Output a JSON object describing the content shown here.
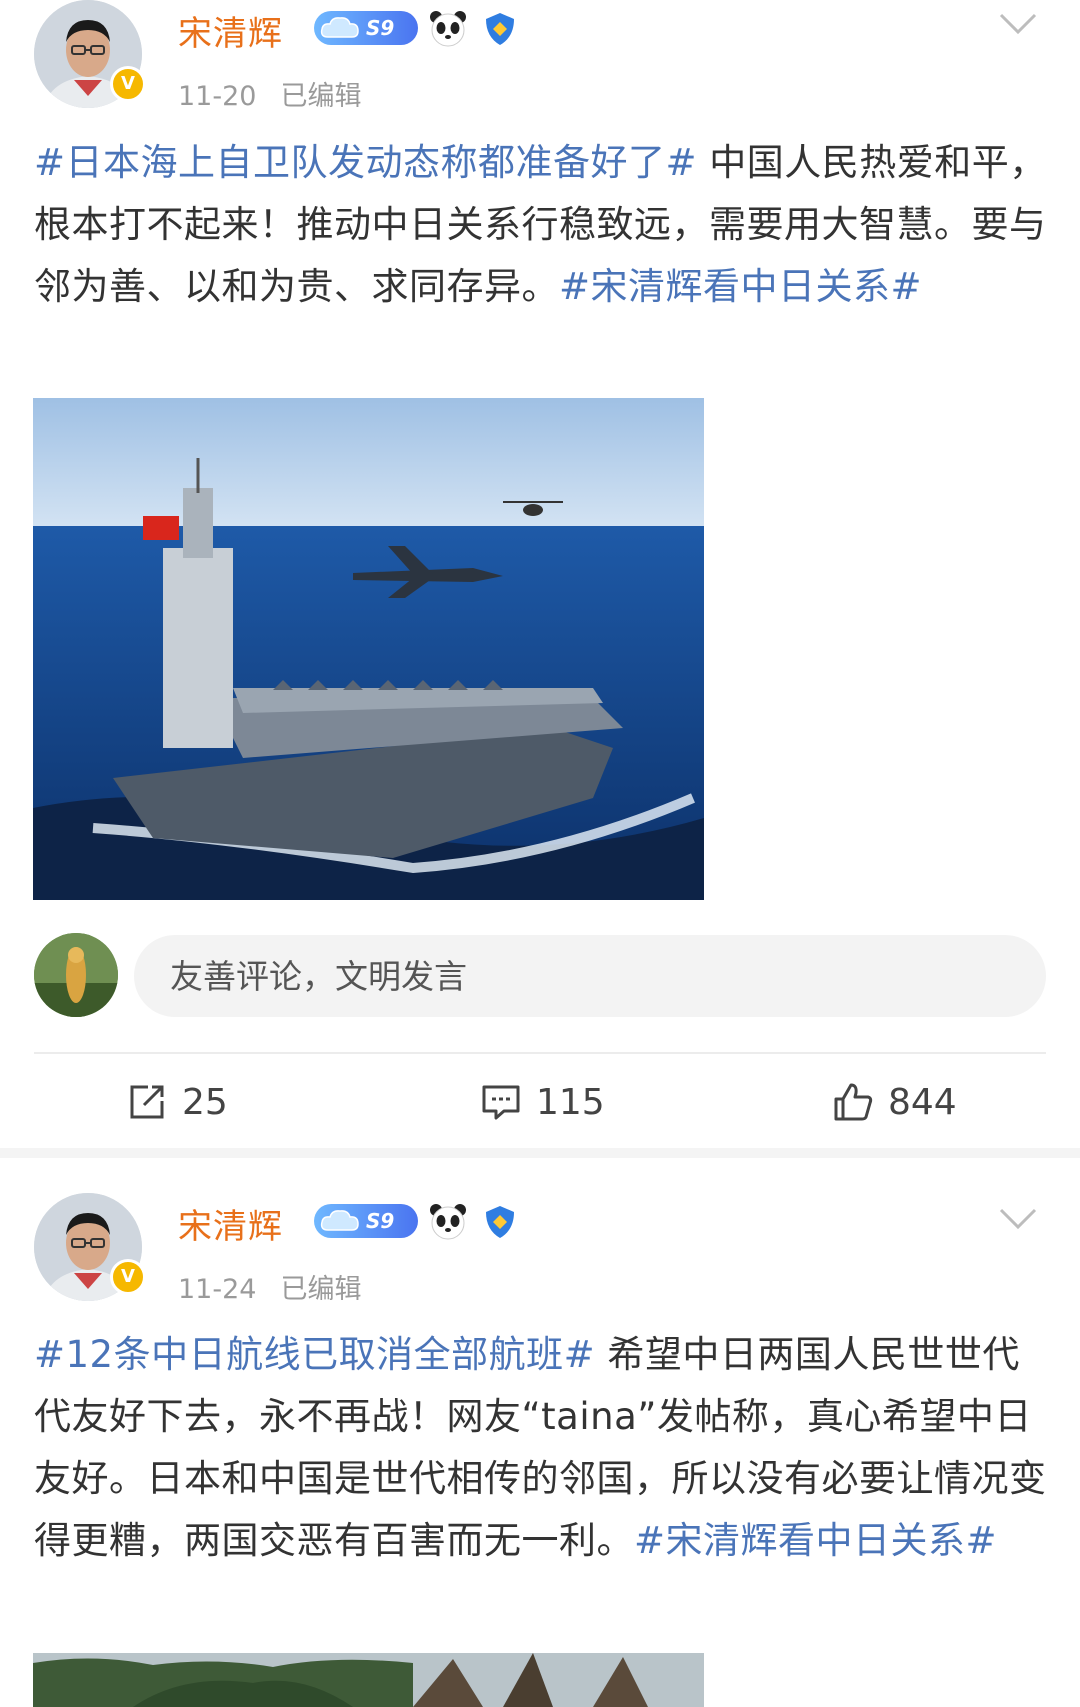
{
  "posts": [
    {
      "author": "宋清辉",
      "level_badge": "S9",
      "date": "11-20",
      "edited_label": "已编辑",
      "text": {
        "hashtag1": "#日本海上自卫队发动态称都准备好了#",
        "body": "中国人民热爱和平，根本打不起来！推动中日关系行稳致远，需要用大智慧。要与邻为善、以和为贵、求同存异。",
        "hashtag2": "#宋清辉看中日关系#"
      },
      "image": {
        "subject": "aircraft-carrier-photo"
      },
      "comment_placeholder": "友善评论，文明发言",
      "actions": {
        "repost": "25",
        "comment": "115",
        "like": "844"
      }
    },
    {
      "author": "宋清辉",
      "level_badge": "S9",
      "date": "11-24",
      "edited_label": "已编辑",
      "text": {
        "hashtag1": "#12条中日航线已取消全部航班#",
        "body": "希望中日两国人民世世代代友好下去，永不再战！网友“taina”发帖称，真心希望中日友好。日本和中国是世代相传的邻国，所以没有必要让情况变得更糟，两国交恶有百害而无一利。",
        "hashtag2": "#宋清辉看中日关系#"
      },
      "image": {
        "subject": "trees-photo"
      }
    }
  ],
  "colors": {
    "username": "#e8701a",
    "hashtag": "#4a74b8",
    "meta": "#9a9a9a",
    "verified_badge": "#f6b800"
  },
  "icons": [
    "chevron-down-icon",
    "repost-icon",
    "comment-icon",
    "like-icon",
    "level-badge-icon",
    "panda-icon",
    "shield-icon",
    "verified-icon"
  ]
}
